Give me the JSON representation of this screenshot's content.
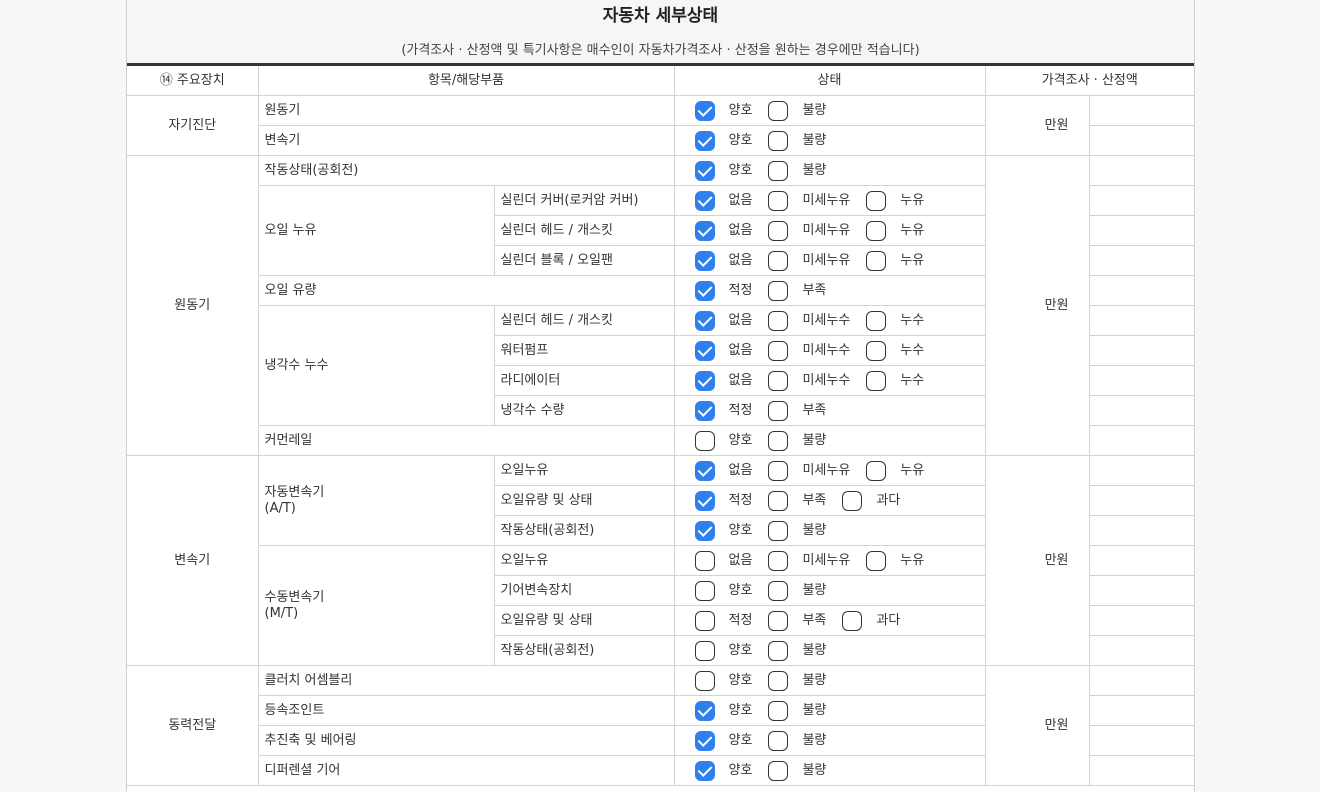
{
  "title": "자동차 세부상태",
  "subtitle": "(가격조사 · 산정액 및 특기사항은 매수인이 자동차가격조사 · 산정을 원하는 경우에만 적습니다)",
  "headers": {
    "device": "⑭ 주요장치",
    "item": "항목/해당부품",
    "state": "상태",
    "price": "가격조사 · 산정액"
  },
  "unit": "만원",
  "labels": {
    "good": "양호",
    "bad": "불량",
    "none": "없음",
    "adequate": "적정",
    "lack": "부족",
    "excess": "과다",
    "minor_leak": "미세누유",
    "leak": "누유",
    "minor_water_leak": "미세누수",
    "water_leak": "누수"
  },
  "sections": {
    "selfdiag": "자기진단",
    "engine": "원동기",
    "transmission": "변속기",
    "power": "동력전달"
  },
  "items": {
    "engine": "원동기",
    "transmission": "변속기",
    "operation": "작동상태(공회전)",
    "oil_leak": "오일 누유",
    "cyl_cover": "실린더 커버(로커암 커버)",
    "cyl_head": "실린더 헤드 / 개스킷",
    "cyl_block": "실린더 블록 / 오일팬",
    "oil_level": "오일 유량",
    "coolant_leak": "냉각수 누수",
    "cyl_head2": "실린더 헤드 / 개스킷",
    "water_pump": "워터펌프",
    "radiator": "라디에이터",
    "coolant_level": "냉각수 수량",
    "common_rail": "커먼레일",
    "auto_trans": "자동변속기",
    "auto_trans_code": "(A/T)",
    "at_oil_leak": "오일누유",
    "at_oil_level": "오일유량 및 상태",
    "at_operation": "작동상태(공회전)",
    "manual_trans": "수동변속기",
    "manual_trans_code": "(M/T)",
    "mt_oil_leak": "오일누유",
    "mt_gear": "기어변속장치",
    "mt_oil_level": "오일유량 및 상태",
    "mt_operation": "작동상태(공회전)",
    "clutch": "클러치 어셈블리",
    "cv_joint": "등속조인트",
    "drive_shaft": "추진축 및 베어링",
    "differential": "디퍼렌셜 기어"
  },
  "checked": {
    "engine": "양호",
    "transmission": "양호",
    "operation": "양호",
    "cyl_cover": "없음",
    "cyl_head": "없음",
    "cyl_block": "없음",
    "oil_level": "적정",
    "cyl_head2": "없음",
    "water_pump": "없음",
    "radiator": "없음",
    "coolant_level": "적정",
    "common_rail": "none",
    "at_oil_leak": "없음",
    "at_oil_level": "적정",
    "at_operation": "양호",
    "mt_oil_leak": "none",
    "mt_gear": "none",
    "mt_oil_level": "none",
    "mt_operation": "none",
    "clutch": "none",
    "cv_joint": "양호",
    "drive_shaft": "양호",
    "differential": "양호"
  },
  "colors": {
    "checked": "#2f80ec",
    "header_rule": "#333333"
  }
}
